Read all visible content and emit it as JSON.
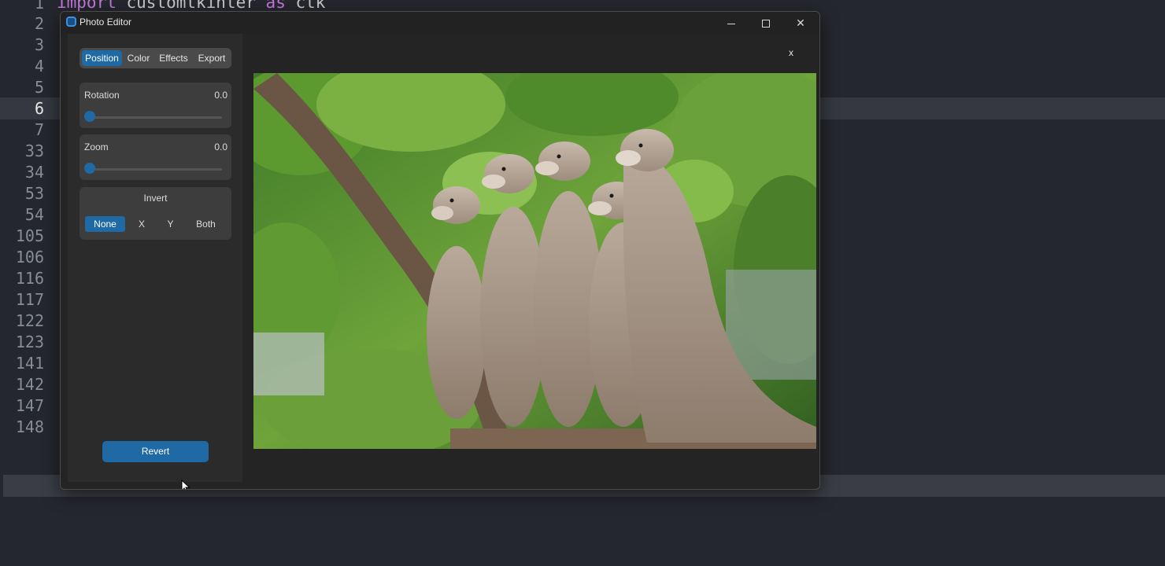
{
  "editor": {
    "code_first_line": {
      "keyword_import": "import",
      "module": "customtkinter",
      "keyword_as": "as",
      "alias": "ctk"
    },
    "line_numbers": [
      "1",
      "2",
      "3",
      "4",
      "5",
      "6",
      "7",
      "33",
      "34",
      "53",
      "54",
      "105",
      "106",
      "116",
      "117",
      "122",
      "123",
      "141",
      "142",
      "147",
      "148"
    ],
    "active_line": "6"
  },
  "window": {
    "title": "Photo Editor",
    "controls": {
      "minimize": "minimize-icon",
      "maximize": "maximize-icon",
      "close": "close-icon"
    }
  },
  "sidebar": {
    "tabs": [
      {
        "label": "Position",
        "active": true
      },
      {
        "label": "Color",
        "active": false
      },
      {
        "label": "Effects",
        "active": false
      },
      {
        "label": "Export",
        "active": false
      }
    ],
    "rotation": {
      "label": "Rotation",
      "value": "0.0",
      "slider_fraction": 0.0
    },
    "zoom": {
      "label": "Zoom",
      "value": "0.0",
      "slider_fraction": 0.0
    },
    "invert": {
      "title": "Invert",
      "options": [
        "None",
        "X",
        "Y",
        "Both"
      ],
      "selected": "None"
    },
    "revert_label": "Revert"
  },
  "image_panel": {
    "close_label": "x",
    "image_subject": "photo of five otters standing upright in a row among green leaves"
  },
  "colors": {
    "accent": "#1f6aa5",
    "window_bg": "#242424",
    "panel_bg": "#3d3d3d",
    "editor_bg": "#25272e"
  }
}
